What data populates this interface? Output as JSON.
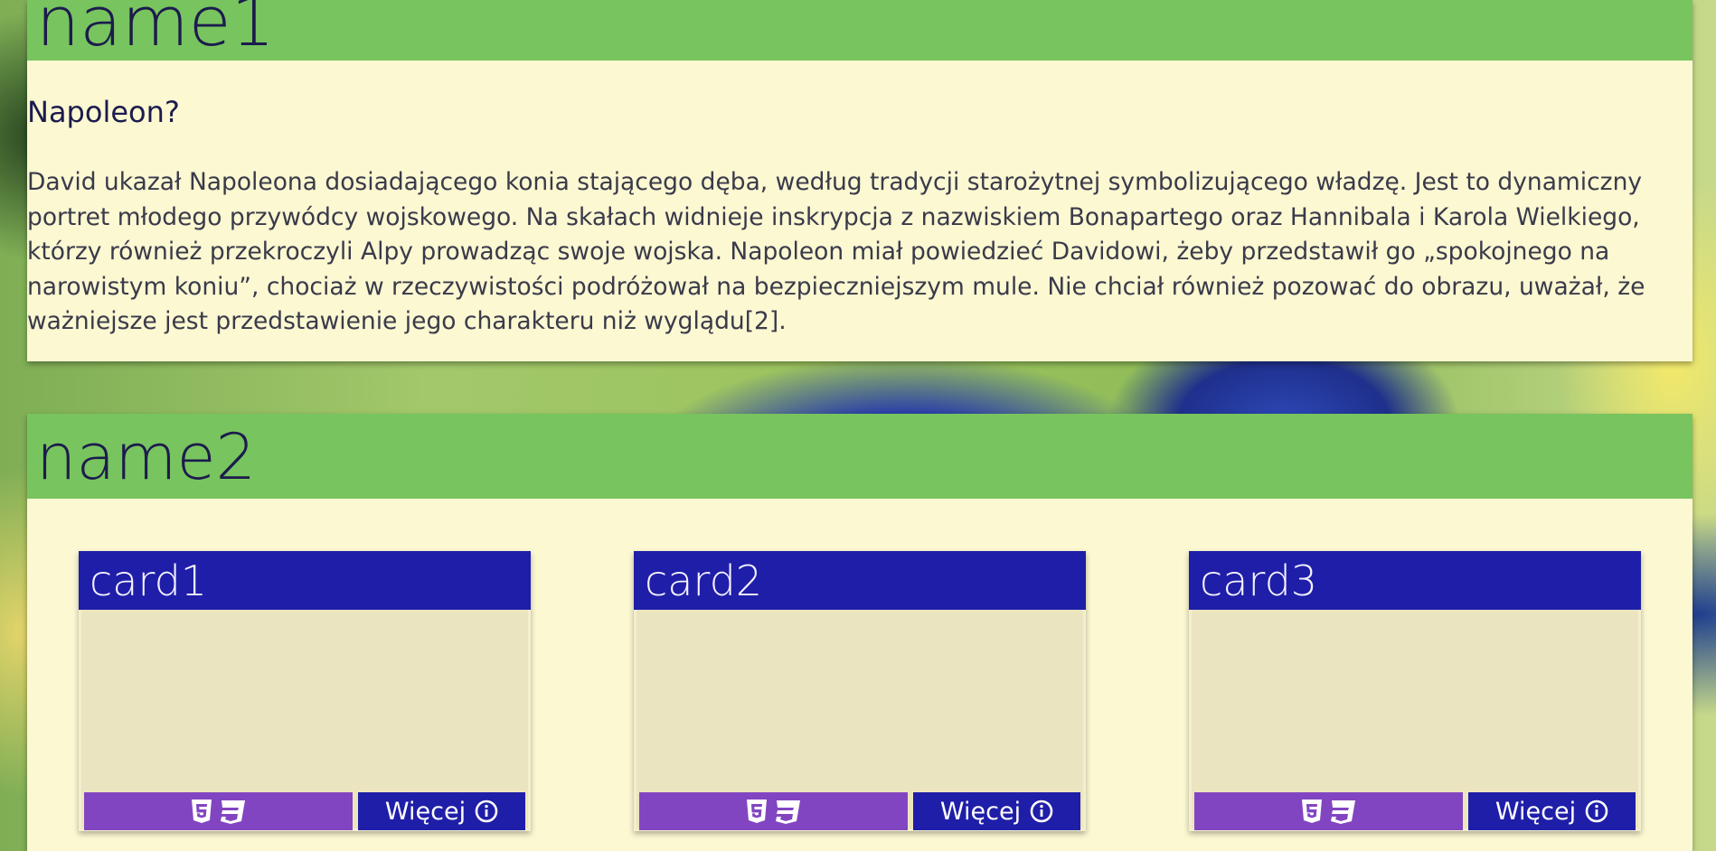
{
  "sections": [
    {
      "title": "name1",
      "article": {
        "heading": "Napoleon?",
        "body": "David ukazał Napoleona dosiadającego konia stającego dęba, według tradycji starożytnej symbolizującego władzę. Jest to dynamiczny portret młodego przywódcy wojskowego. Na skałach widnieje inskrypcja z nazwiskiem Bonapartego oraz Hannibala i Karola Wielkiego, którzy również przekroczyli Alpy prowadząc swoje wojska. Napoleon miał powiedzieć Davidowi, żeby przedstawił go „spokojnego na narowistym koniu”, chociaż w rzeczywistości podróżował na bezpieczniejszym mule. Nie chciał również pozować do obrazu, uważał, że ważniejsze jest przedstawienie jego charakteru niż wyglądu[2]."
      }
    },
    {
      "title": "name2",
      "cards": [
        {
          "title": "card1",
          "more_label": "Więcej",
          "tech_icons": [
            "html5-icon",
            "css3-icon"
          ],
          "info_icon": "info-icon"
        },
        {
          "title": "card2",
          "more_label": "Więcej",
          "tech_icons": [
            "html5-icon",
            "css3-icon"
          ],
          "info_icon": "info-icon"
        },
        {
          "title": "card3",
          "more_label": "Więcej",
          "tech_icons": [
            "html5-icon",
            "css3-icon"
          ],
          "info_icon": "info-icon"
        }
      ]
    }
  ],
  "colors": {
    "section_header": "#78c45e",
    "section_background": "#fbf8d2",
    "card_header": "#1f1ea8",
    "tech_button": "#8245c1",
    "more_button": "#1f1ea8",
    "title_text": "#1c1b4d"
  }
}
